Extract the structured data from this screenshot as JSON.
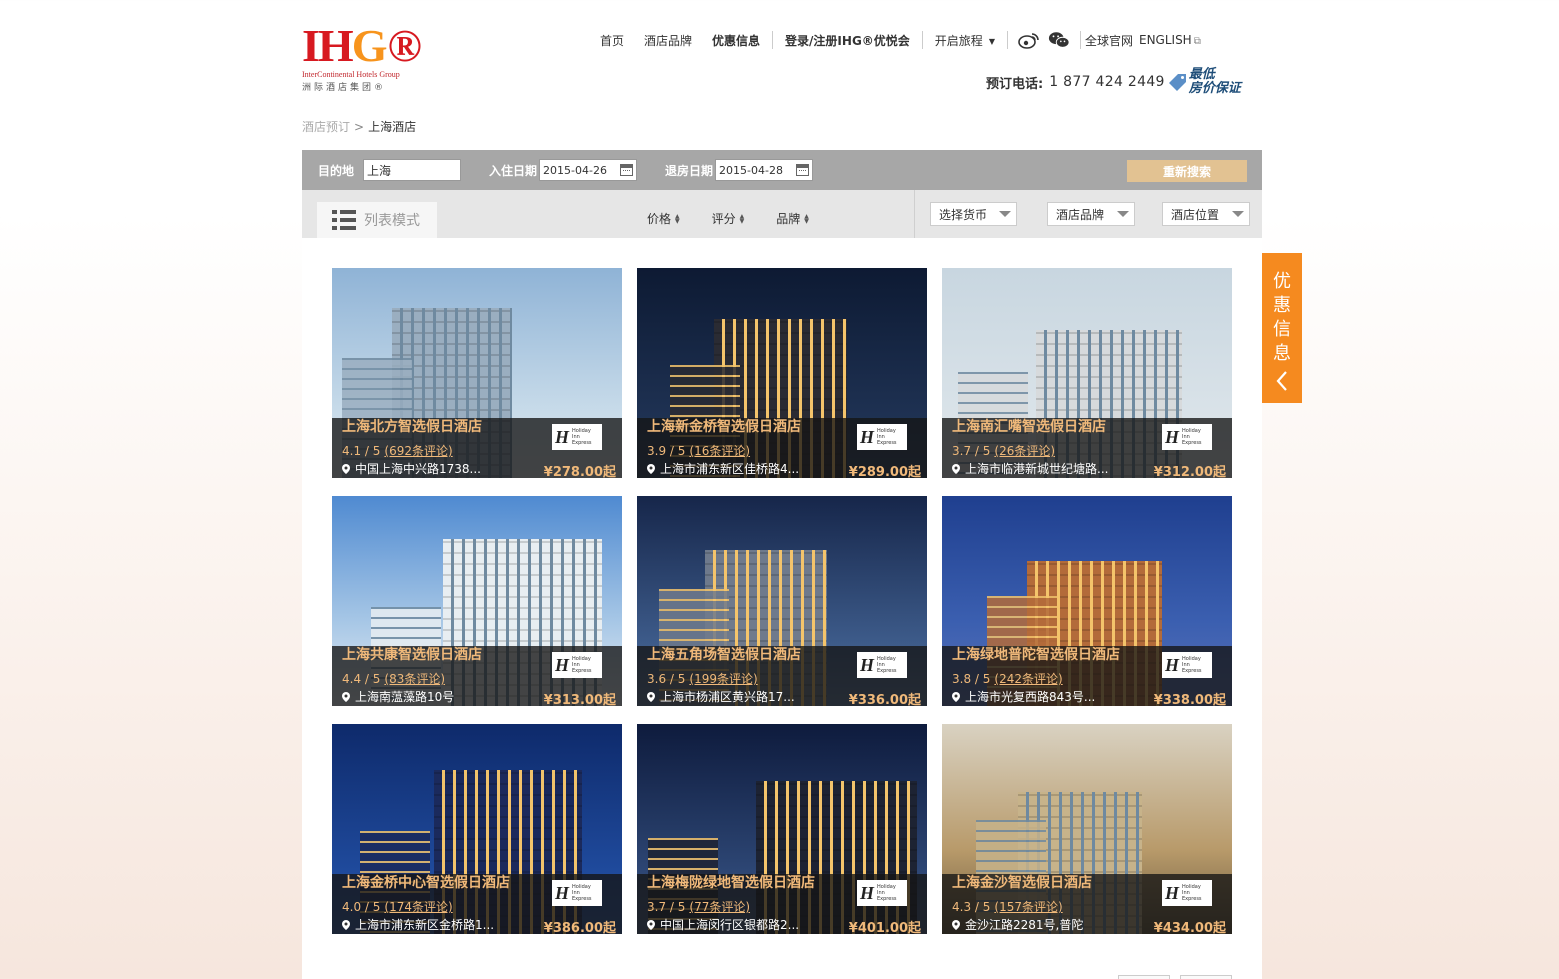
{
  "brand": {
    "logo_text_i": "I",
    "logo_text_h": "H",
    "logo_text_g": "G",
    "logo_reg": "®",
    "logo_en": "InterContinental Hotels Group",
    "logo_cn": "洲际酒店集团®",
    "colors": {
      "red": "#d71920",
      "orange": "#f7941d"
    }
  },
  "nav": {
    "home": "首页",
    "brands": "酒店品牌",
    "offers": "优惠信息",
    "login": "登录/注册IHG®优悦会",
    "travel": "开启旅程",
    "weibo_icon": "weibo-icon",
    "wechat_icon": "wechat-icon",
    "global": "全球官网",
    "english": "ENGLISH"
  },
  "booking": {
    "phone_label": "预订电话:",
    "phone_number": "1 877 424 2449",
    "guarantee_line1": "最低",
    "guarantee_line2": "房价保证"
  },
  "breadcrumb": {
    "root": "酒店预订",
    "separator": ">",
    "current": "上海酒店"
  },
  "search": {
    "destination_label": "目的地",
    "destination_value": "上海",
    "checkin_label": "入住日期",
    "checkin_value": "2015-04-26",
    "checkout_label": "退房日期",
    "checkout_value": "2015-04-28",
    "button": "重新搜索"
  },
  "filters": {
    "view_mode": "列表模式",
    "sort_price": "价格",
    "sort_rating": "评分",
    "sort_brand": "品牌",
    "currency": "选择货币",
    "brand": "酒店品牌",
    "location": "酒店位置"
  },
  "side_tab": {
    "chars": [
      "优",
      "惠",
      "信",
      "息"
    ],
    "accent": "#f58a1f"
  },
  "hotels": [
    {
      "name": "上海北方智选假日酒店",
      "rating": "4.1 / 5",
      "reviews": "(692条评论)",
      "address": "中国上海中兴路1738...",
      "price": "¥278.00起",
      "brand": "Holiday Inn Express"
    },
    {
      "name": "上海新金桥智选假日酒店",
      "rating": "3.9 / 5",
      "reviews": "(16条评论)",
      "address": "上海市浦东新区佳桥路4...",
      "price": "¥289.00起",
      "brand": "Holiday Inn Express"
    },
    {
      "name": "上海南汇嘴智选假日酒店",
      "rating": "3.7 / 5",
      "reviews": "(26条评论)",
      "address": "上海市临港新城世纪塘路...",
      "price": "¥312.00起",
      "brand": "Holiday Inn Express"
    },
    {
      "name": "上海共康智选假日酒店",
      "rating": "4.4 / 5",
      "reviews": "(83条评论)",
      "address": "上海南蕰藻路10号",
      "price": "¥313.00起",
      "brand": "Holiday Inn Express"
    },
    {
      "name": "上海五角场智选假日酒店",
      "rating": "3.6 / 5",
      "reviews": "(199条评论)",
      "address": "上海市杨浦区黄兴路17...",
      "price": "¥336.00起",
      "brand": "Holiday Inn Express"
    },
    {
      "name": "上海绿地普陀智选假日酒店",
      "rating": "3.8 / 5",
      "reviews": "(242条评论)",
      "address": "上海市光复西路843号...",
      "price": "¥338.00起",
      "brand": "Holiday Inn Express"
    },
    {
      "name": "上海金桥中心智选假日酒店",
      "rating": "4.0 / 5",
      "reviews": "(174条评论)",
      "address": "上海市浦东新区金桥路1...",
      "price": "¥386.00起",
      "brand": "Holiday Inn Express"
    },
    {
      "name": "上海梅陇绿地智选假日酒店",
      "rating": "3.7 / 5",
      "reviews": "(77条评论)",
      "address": "中国上海闵行区银都路2...",
      "price": "¥401.00起",
      "brand": "Holiday Inn Express"
    },
    {
      "name": "上海金沙智选假日酒店",
      "rating": "4.3 / 5",
      "reviews": "(157条评论)",
      "address": "金沙江路2281号,普陀",
      "price": "¥434.00起",
      "brand": "Holiday Inn Express"
    }
  ],
  "card_text_color": "#f0b97a"
}
